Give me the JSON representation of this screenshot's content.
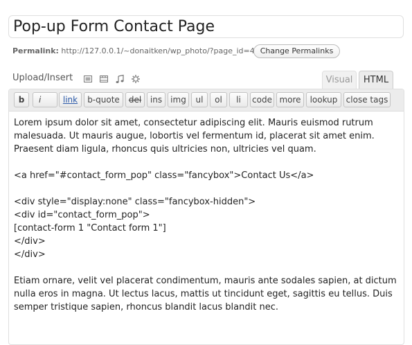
{
  "post": {
    "title": "Pop-up Form Contact Page",
    "permalink_label": "Permalink:",
    "permalink_url": "http://127.0.0.1/~donaitken/wp_photo/?page_id=4",
    "change_permalinks_label": "Change Permalinks"
  },
  "media": {
    "label": "Upload/Insert",
    "icons": [
      "image-icon",
      "video-icon",
      "audio-icon",
      "media-icon"
    ]
  },
  "editor_tabs": {
    "visual": "Visual",
    "html": "HTML",
    "active": "HTML"
  },
  "quicktags": {
    "b": "b",
    "i": "i",
    "link": "link",
    "bquote": "b-quote",
    "del": "del",
    "ins": "ins",
    "img": "img",
    "ul": "ul",
    "ol": "ol",
    "li": "li",
    "code": "code",
    "more": "more",
    "lookup": "lookup",
    "close": "close tags"
  },
  "content": {
    "p1": "Lorem ipsum dolor sit amet, consectetur adipiscing elit. Mauris euismod rutrum malesuada. Ut mauris augue, lobortis vel fermentum id, placerat sit amet enim. Praesent diam ligula, rhoncus quis ultricies non, ultricies vel quam.",
    "l1": "<a href=\"#contact_form_pop\" class=\"fancybox\">Contact Us</a>",
    "l2": "<div style=\"display:none\" class=\"fancybox-hidden\">",
    "l3": "<div id=\"contact_form_pop\">",
    "l4": "[contact-form 1 \"Contact form 1\"]",
    "l5": "</div>",
    "l6": "</div>",
    "p2": "Etiam ornare, velit vel placerat condimentum, mauris ante sodales sapien, at dictum nulla eros in magna. Ut lectus lacus, mattis ut tincidunt eget, sagittis eu tellus. Duis semper tristique sapien, rhoncus blandit lacus blandit nec."
  }
}
